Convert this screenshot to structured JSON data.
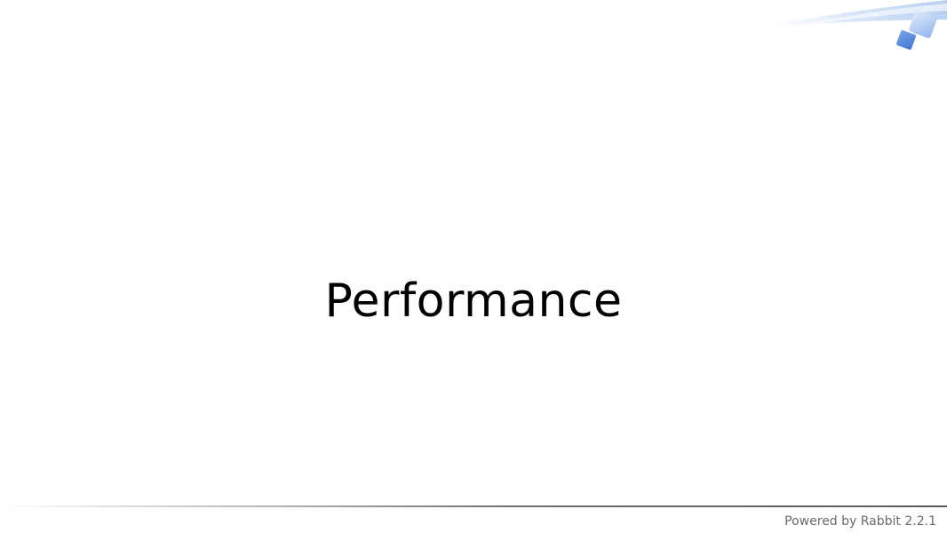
{
  "slide": {
    "title": "Performance"
  },
  "footer": {
    "powered_by": "Powered by Rabbit 2.2.1"
  },
  "decoration": {
    "icon": "rabbit-theme-corner-decoration",
    "colors": {
      "swoosh": "#c9dcf7",
      "square_light": "#bcd3f5",
      "square_dark": "#5c8fe0"
    }
  }
}
